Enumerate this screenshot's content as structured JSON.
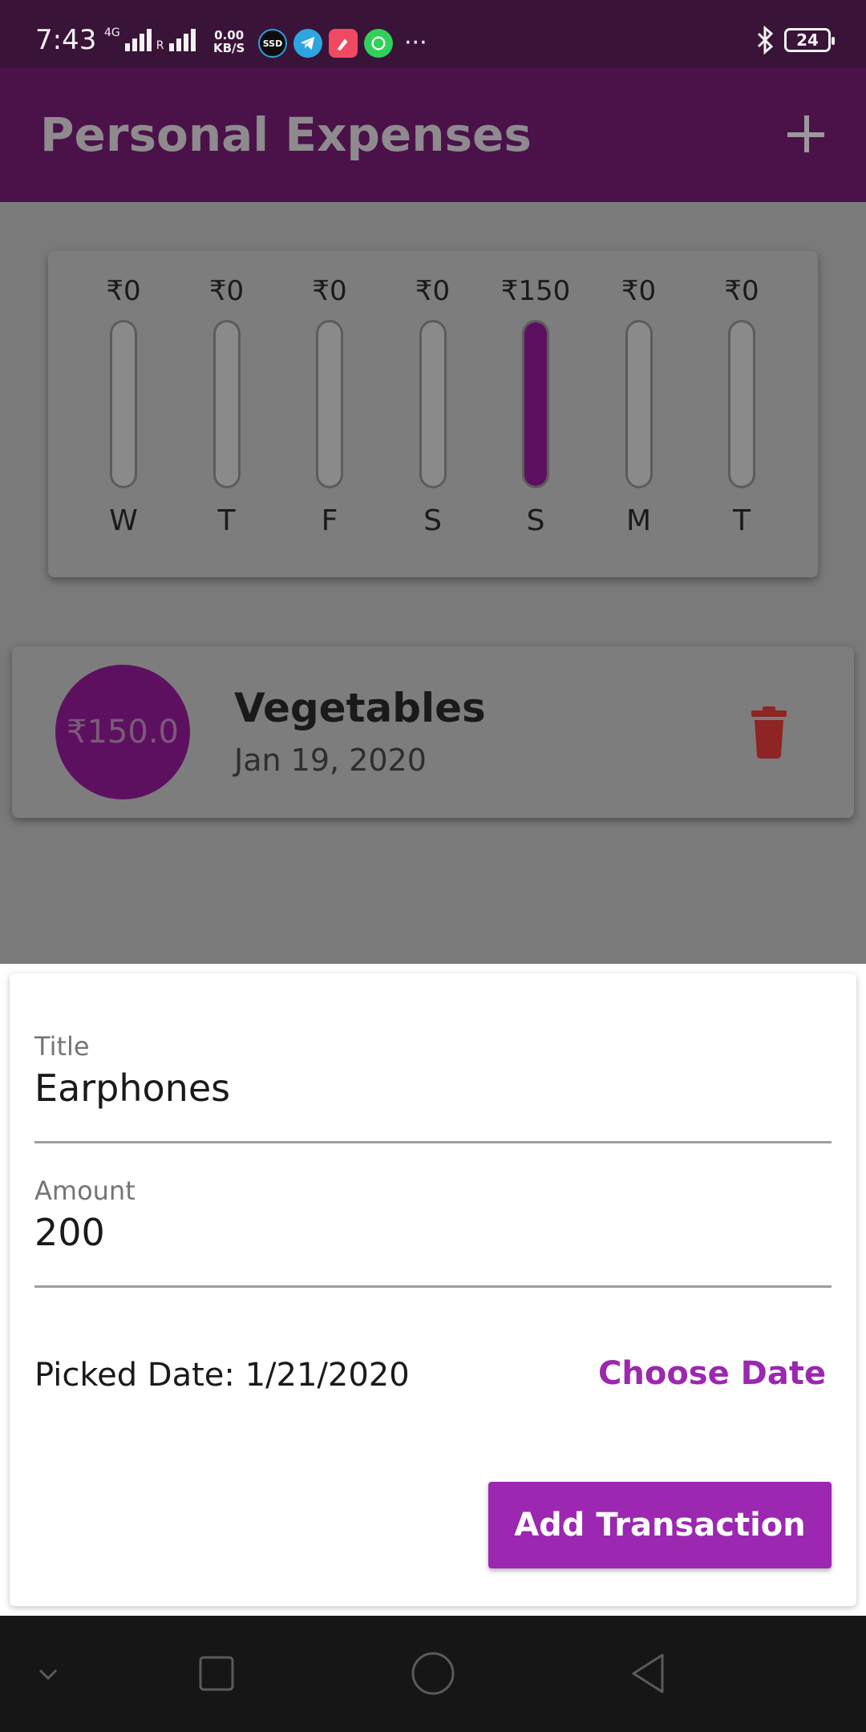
{
  "status_bar": {
    "time": "7:43",
    "network": "4G",
    "roaming": "R",
    "speed_value": "0.00",
    "speed_unit": "KB/S",
    "more": "···",
    "battery": "24",
    "apps": [
      "ssd-icon",
      "telegram-icon",
      "app-icon",
      "whatsapp-icon"
    ]
  },
  "app_bar": {
    "title": "Personal Expenses",
    "add_icon": "plus-icon"
  },
  "chart": {
    "max_value": 150,
    "days": [
      {
        "label": "W",
        "amount": "₹0",
        "value": 0
      },
      {
        "label": "T",
        "amount": "₹0",
        "value": 0
      },
      {
        "label": "F",
        "amount": "₹0",
        "value": 0
      },
      {
        "label": "S",
        "amount": "₹0",
        "value": 0
      },
      {
        "label": "S",
        "amount": "₹150",
        "value": 150
      },
      {
        "label": "M",
        "amount": "₹0",
        "value": 0
      },
      {
        "label": "T",
        "amount": "₹0",
        "value": 0
      }
    ]
  },
  "transactions": [
    {
      "amount": "₹150.0",
      "title": "Vegetables",
      "date": "Jan 19, 2020",
      "action_icon": "delete-icon"
    }
  ],
  "form": {
    "title_label": "Title",
    "title_value": "Earphones",
    "amount_label": "Amount",
    "amount_value": "200",
    "picked_date": "Picked Date: 1/21/2020",
    "choose_date_label": "Choose Date",
    "submit_label": "Add Transaction"
  },
  "colors": {
    "primary": "#9c27b0",
    "app_bar": "#4a1249",
    "delete": "#c62828"
  }
}
